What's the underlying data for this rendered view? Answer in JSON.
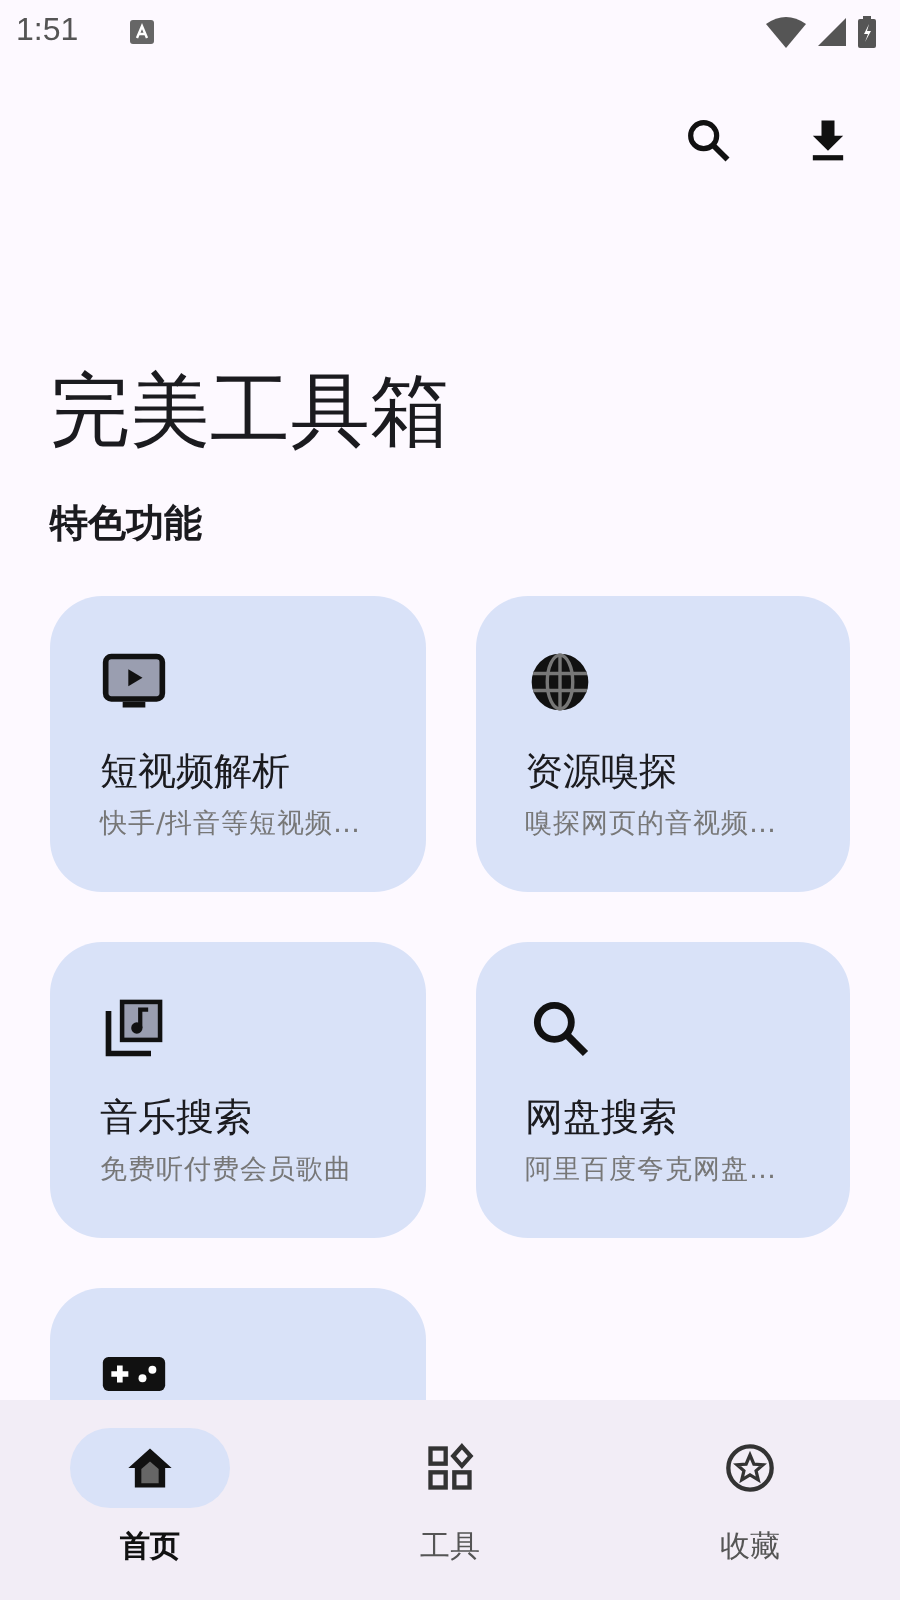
{
  "status_bar": {
    "time": "1:51"
  },
  "title": "完美工具箱",
  "section": "特色功能",
  "features": [
    {
      "kind": "tv",
      "title": "短视频解析",
      "subtitle": "快手/抖音等短视频…"
    },
    {
      "kind": "globe",
      "title": "资源嗅探",
      "subtitle": "嗅探网页的音视频…"
    },
    {
      "kind": "music",
      "title": "音乐搜索",
      "subtitle": "免费听付费会员歌曲"
    },
    {
      "kind": "search",
      "title": "网盘搜索",
      "subtitle": "阿里百度夸克网盘…"
    },
    {
      "kind": "game"
    }
  ],
  "nav": [
    {
      "kind": "home",
      "label": "首页",
      "selected": true
    },
    {
      "kind": "apps",
      "label": "工具",
      "selected": false
    },
    {
      "kind": "star",
      "label": "收藏",
      "selected": false
    }
  ]
}
